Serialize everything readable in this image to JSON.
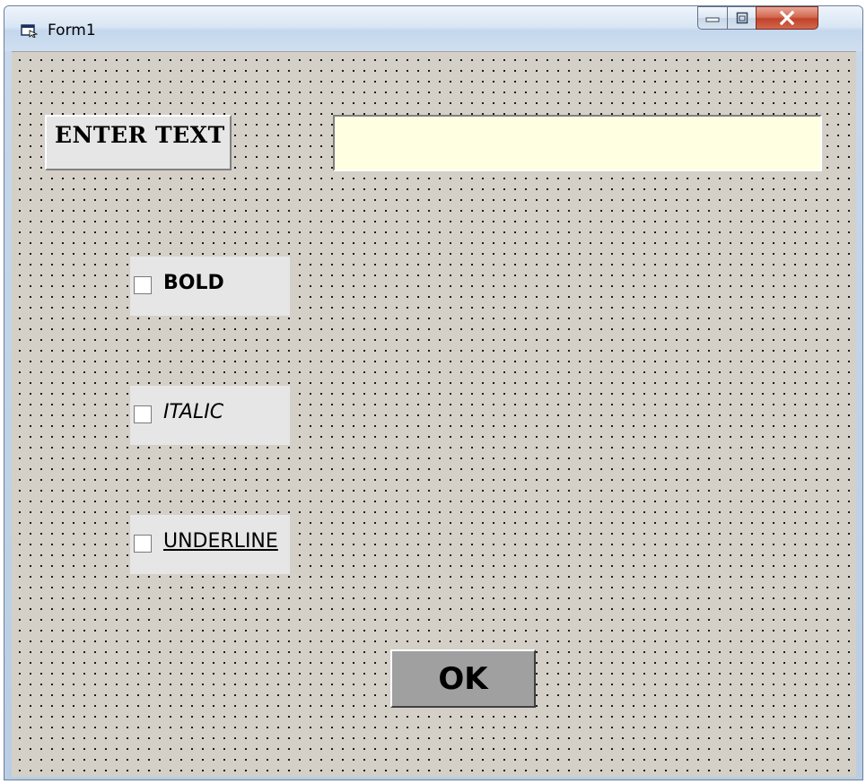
{
  "window": {
    "title": "Form1",
    "controls": {
      "minimize_icon": "minimize-icon",
      "maximize_icon": "maximize-icon",
      "close_icon": "close-icon"
    }
  },
  "form": {
    "enter_text_label": "ENTER TEXT",
    "text_input_value": "",
    "checkboxes": [
      {
        "label": "BOLD",
        "checked": false,
        "style": "bold"
      },
      {
        "label": "ITALIC",
        "checked": false,
        "style": "italic"
      },
      {
        "label": "UNDERLINE",
        "checked": false,
        "style": "underline"
      }
    ],
    "ok_button_label": "OK"
  },
  "colors": {
    "form_background": "#d4d0c8",
    "text_input_background": "#ffffe1",
    "ok_button_background": "#a0a0a0",
    "close_button": "#c0432a"
  }
}
